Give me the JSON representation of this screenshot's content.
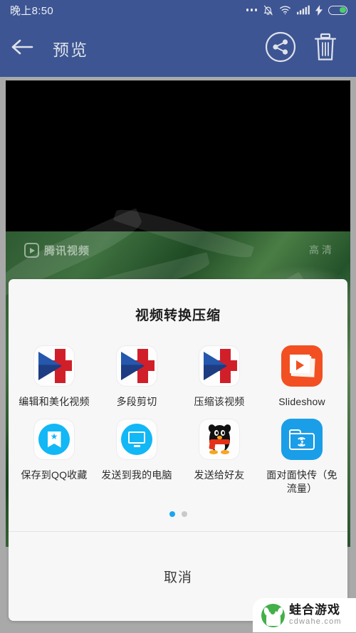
{
  "statusbar": {
    "time": "晚上8:50",
    "icons": [
      "more-dots-icon",
      "silent-bell-icon",
      "wifi-icon",
      "signal-bars-icon",
      "charging-bolt-icon",
      "battery-icon"
    ]
  },
  "appbar": {
    "back_icon": "back-arrow-icon",
    "title": "预览",
    "share_icon": "share-icon",
    "delete_icon": "trash-icon"
  },
  "video": {
    "watermark_text": "腾讯视频",
    "quality_label": "高清",
    "play_icon": "play-icon"
  },
  "sheet": {
    "title": "视频转换压缩",
    "apps": [
      {
        "label": "编辑和美化视频",
        "icon": "video-editor-icon"
      },
      {
        "label": "多段剪切",
        "icon": "video-editor-icon"
      },
      {
        "label": "压缩该视频",
        "icon": "video-editor-icon"
      },
      {
        "label": "Slideshow",
        "icon": "slideshow-icon"
      },
      {
        "label": "保存到QQ收藏",
        "icon": "qq-favorites-icon"
      },
      {
        "label": "发送到我的电脑",
        "icon": "my-computer-icon"
      },
      {
        "label": "发送给好友",
        "icon": "qq-penguin-icon"
      },
      {
        "label": "面对面快传（免流量）",
        "icon": "face-to-face-transfer-icon"
      }
    ],
    "pager": {
      "total": 2,
      "active": 1
    },
    "cancel_label": "取消"
  },
  "watermark": {
    "name": "蛙合游戏",
    "domain": "cdwahe.com"
  },
  "colors": {
    "appbar": "#3d5593",
    "accent_blue": "#1ba5f0",
    "qq_blue": "#12b7f5",
    "slideshow_orange": "#f25022",
    "transfer_blue": "#1a9ee8",
    "battery_green": "#4ad06a",
    "watermark_green": "#43b04a"
  }
}
